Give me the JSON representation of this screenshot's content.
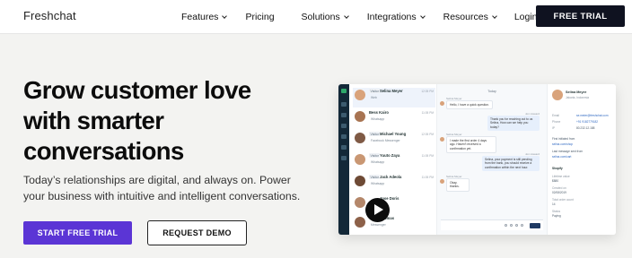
{
  "nav": {
    "logo": "Freshchat",
    "items": [
      {
        "label": "Features",
        "dropdown": true
      },
      {
        "label": "Pricing",
        "dropdown": false
      },
      {
        "label": "Solutions",
        "dropdown": true
      },
      {
        "label": "Integrations",
        "dropdown": true
      },
      {
        "label": "Resources",
        "dropdown": true
      },
      {
        "label": "Login",
        "dropdown": false
      }
    ],
    "cta": "FREE TRIAL"
  },
  "hero": {
    "headline_lines": [
      "Grow customer love",
      "with smarter",
      "conversations"
    ],
    "subtext_lines": [
      "Today’s relationships are digital, and always on. Power",
      "your business with intuitive and intelligent conversations."
    ],
    "primary_button": "START FREE TRIAL",
    "secondary_button": "REQUEST DEMO"
  },
  "mockup": {
    "conversations": [
      {
        "tag": "Visitor",
        "name": "Selina Meyer",
        "channel": "Web",
        "time": "12:05 PM",
        "active": true
      },
      {
        "tag": "",
        "name": "Bess Kairo",
        "channel": "Whatsapp",
        "time": "11:05 PM",
        "active": false
      },
      {
        "tag": "Visitor",
        "name": "Michael Young",
        "channel": "Facebook Messenger",
        "time": "12:05 PM",
        "active": false
      },
      {
        "tag": "Visitor",
        "name": "Yuuto Zaya",
        "channel": "Whatsapp",
        "time": "11:05 PM",
        "active": false
      },
      {
        "tag": "Visitor",
        "name": "Jack Adeola",
        "channel": "Whatsapp",
        "time": "11:05 PM",
        "active": false
      },
      {
        "tag": "",
        "name": "Jose Doris",
        "channel": "Messenger",
        "time": "",
        "active": false
      },
      {
        "tag": "",
        "name": "Thomas",
        "channel": "Messenger",
        "time": "",
        "active": false
      }
    ],
    "chat": {
      "day": "Today",
      "messages": [
        {
          "who": "Selina Meyer",
          "text": "Hello, I have a quick question.",
          "side": "in"
        },
        {
          "who": "Jon Howard",
          "text": "Thank you for reaching out to us Selina, How can we help you today?",
          "side": "out"
        },
        {
          "who": "Selina Meyer",
          "text": "I made the first order 4 days ago. Haven't received a confirmation yet.",
          "side": "in"
        },
        {
          "who": "Jon Howard",
          "text": "Selina, your payment is still pending from the bank, you should receive a confirmation within the next hour.",
          "side": "out"
        },
        {
          "who": "Selina Meyer",
          "text": "Okay, thanks.",
          "side": "in"
        }
      ]
    },
    "profile": {
      "name": "Selina Meyer",
      "location": "Jakarta, Indonesia",
      "fields": [
        {
          "label": "Email",
          "value": "se.meier@freshchat.com"
        },
        {
          "label": "Phone",
          "value": "+91 9182779182"
        },
        {
          "label": "IP",
          "value": "80.232.12.188"
        }
      ],
      "first_initiated_label": "First initiated from",
      "first_initiated_value": "selina.com/shop",
      "last_message_label": "Last message sent from",
      "last_message_value": "selina.com/cart",
      "shopify_label": "Shopify",
      "orders": [
        {
          "label": "Lifetime value",
          "value": "$880"
        },
        {
          "label": "Created on",
          "value": "02/08/2019"
        },
        {
          "label": "Total order count",
          "value": "14"
        },
        {
          "label": "Status",
          "value": "Paying"
        }
      ]
    }
  }
}
